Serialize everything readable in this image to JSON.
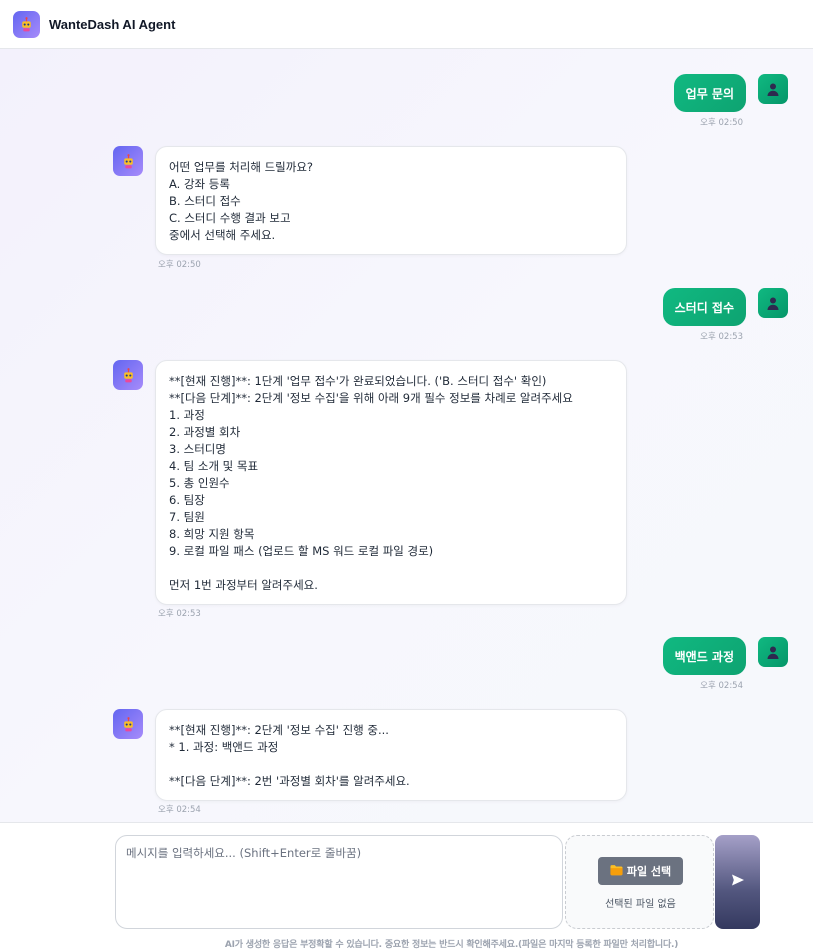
{
  "app": {
    "title": "WanteDash AI Agent"
  },
  "messages": [
    {
      "role": "user",
      "text": "업무 문의",
      "time": "오후 02:50"
    },
    {
      "role": "bot",
      "lines": [
        "어떤 업무를 처리해 드릴까요?",
        "A. 강좌 등록",
        "B. 스터디 접수",
        "C. 스터디 수행 결과 보고",
        "중에서 선택해 주세요."
      ],
      "time": "오후 02:50"
    },
    {
      "role": "user",
      "text": "스터디 접수",
      "time": "오후 02:53"
    },
    {
      "role": "bot",
      "lines": [
        "**[현재 진행]**: 1단계 '업무 접수'가 완료되었습니다. ('B. 스터디 접수' 확인)",
        "**[다음 단계]**: 2단계 '정보 수집'을 위해 아래 9개 필수 정보를 차례로 알려주세요",
        "1. 과정",
        "2. 과정별 회차",
        "3. 스터디명",
        "4. 팀 소개 및 목표",
        "5. 총 인원수",
        "6. 팀장",
        "7. 팀원",
        "8. 희망 지원 항목",
        "9. 로컬 파일 패스 (업로드 할 MS 워드 로컬 파일 경로)",
        "",
        "먼저 1번 과정부터 알려주세요."
      ],
      "time": "오후 02:53"
    },
    {
      "role": "user",
      "text": "백앤드 과정",
      "time": "오후 02:54"
    },
    {
      "role": "bot",
      "lines": [
        "**[현재 진행]**: 2단계 '정보 수집' 진행 중...",
        "* 1. 과정: 백앤드 과정",
        "",
        "**[다음 단계]**: 2번 '과정별 회차'를 알려주세요."
      ],
      "time": "오후 02:54"
    }
  ],
  "composer": {
    "placeholder": "메시지를 입력하세요... (Shift+Enter로 줄바꿈)",
    "file_button_label": "파일 선택",
    "file_icon": "folder-icon",
    "file_status": "선택된 파일 없음",
    "send_icon": "send-icon"
  },
  "disclaimer": "AI가 생성한 응답은 부정확할 수 있습니다. 중요한 정보는 반드시 확인해주세요.(파일은 마지막 등록한 파일만 처리합니다.)",
  "colors": {
    "user_bubble": "#10b981",
    "bot_avatar": "#6366f1",
    "send_button": "#52567e"
  }
}
